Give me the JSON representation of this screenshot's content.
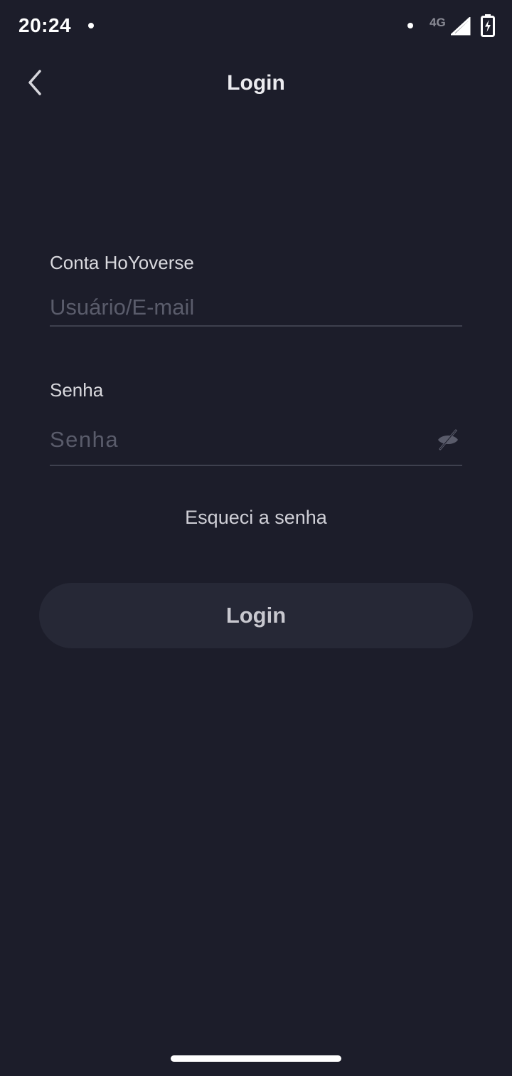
{
  "status_bar": {
    "time": "20:24",
    "network_type": "4G",
    "icons": [
      "notification-dot-icon",
      "signal-icon",
      "battery-charging-icon"
    ]
  },
  "header": {
    "title": "Login",
    "back_icon": "chevron-left-icon"
  },
  "form": {
    "account": {
      "label": "Conta HoYoverse",
      "placeholder": "Usuário/E-mail",
      "value": ""
    },
    "password": {
      "label": "Senha",
      "placeholder": "Senha",
      "value": "",
      "toggle_icon": "eye-off-icon"
    },
    "forgot_password": "Esqueci a senha",
    "submit_label": "Login"
  },
  "colors": {
    "background": "#1c1d2a",
    "button_background": "#262836",
    "divider": "#3e404e",
    "placeholder": "#5a5c6b"
  }
}
